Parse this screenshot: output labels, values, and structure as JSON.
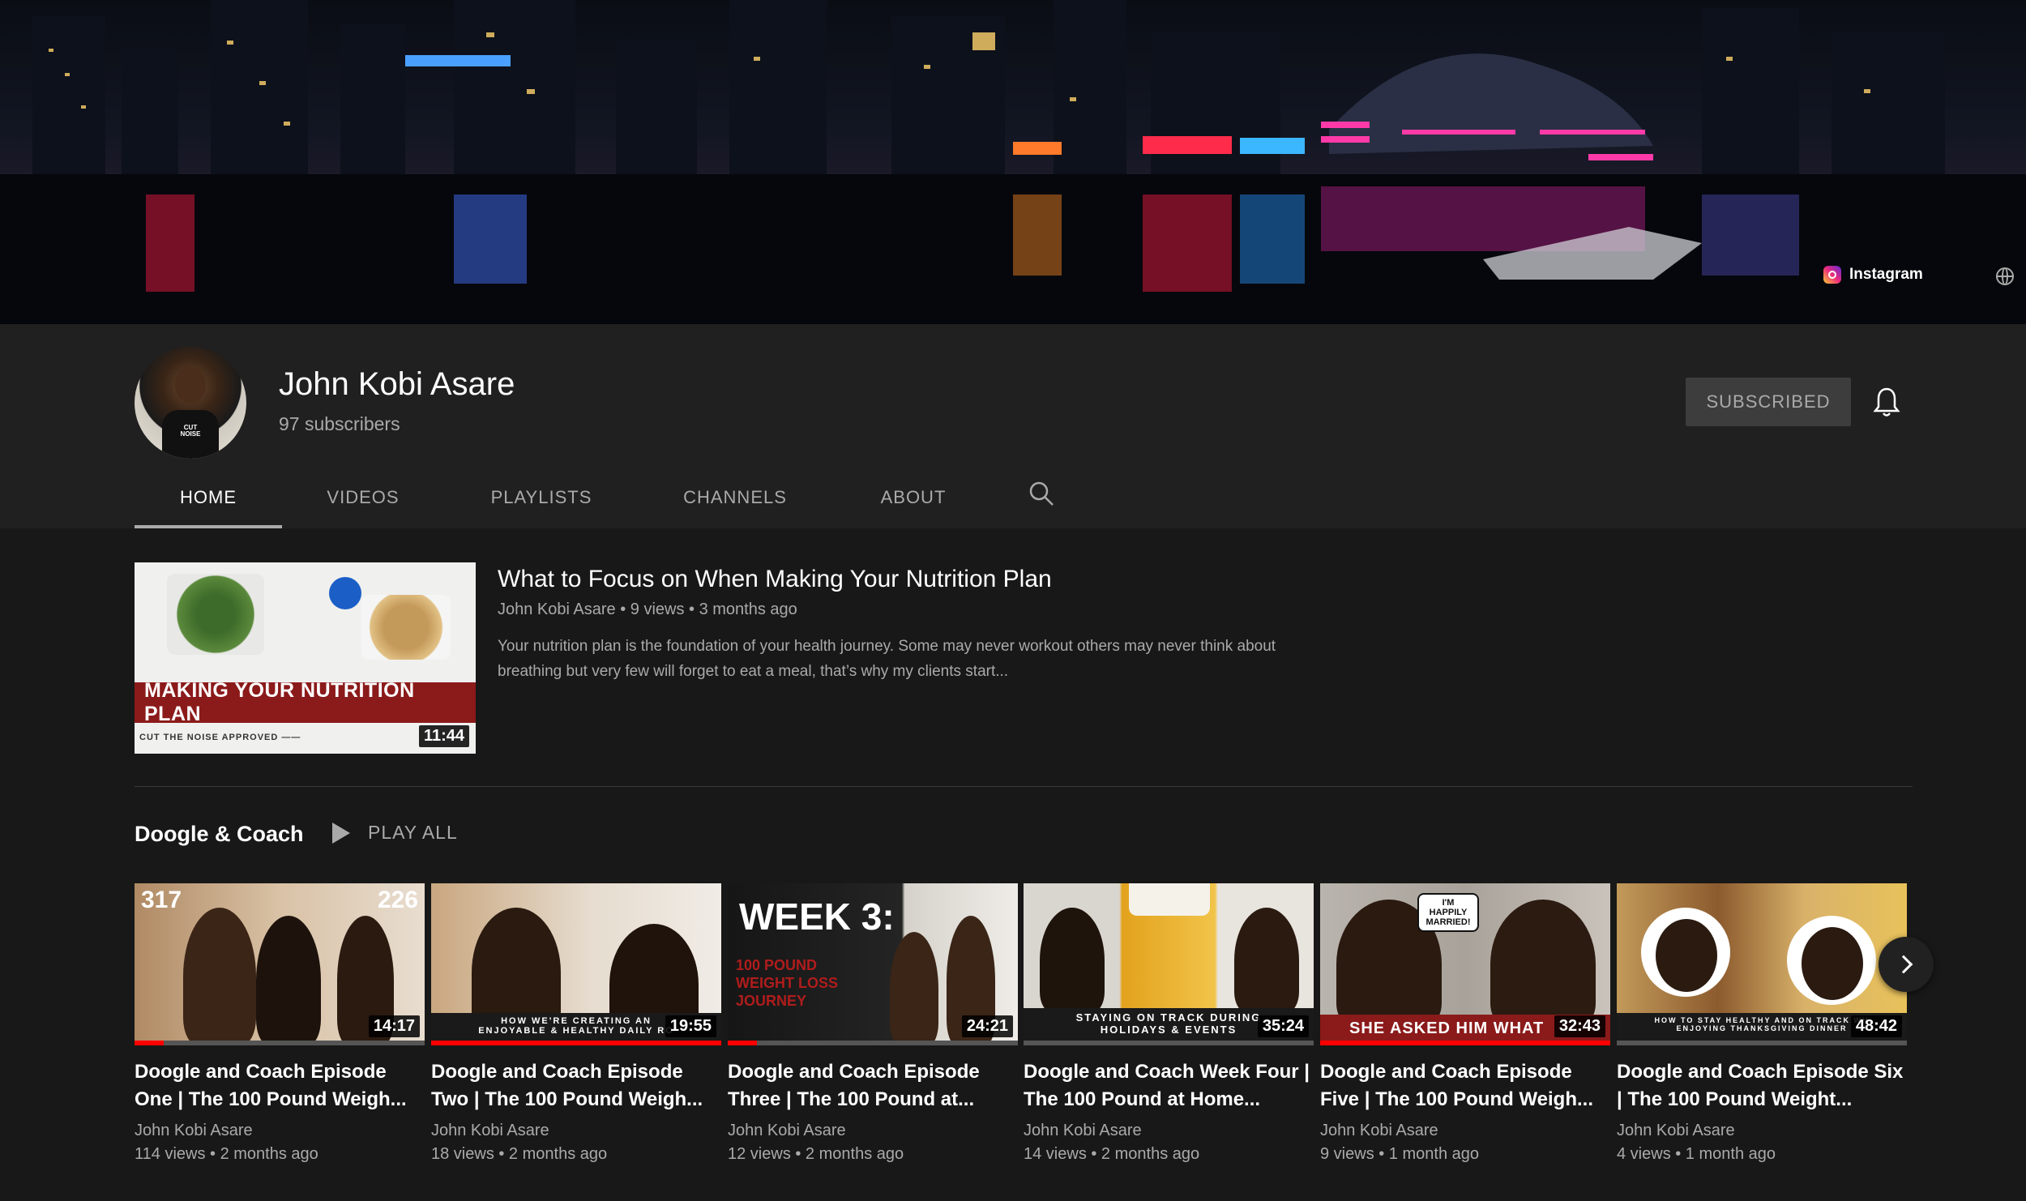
{
  "banner": {
    "links": [
      {
        "label": "Instagram",
        "icon": "instagram-icon"
      }
    ],
    "globe_icon": "globe-icon"
  },
  "channel": {
    "name": "John Kobi Asare",
    "subscribers": "97 subscribers",
    "subscribe_label": "SUBSCRIBED",
    "avatar_text": "CUT NOISE"
  },
  "tabs": [
    {
      "label": "HOME",
      "active": true
    },
    {
      "label": "VIDEOS",
      "active": false
    },
    {
      "label": "PLAYLISTS",
      "active": false
    },
    {
      "label": "CHANNELS",
      "active": false
    },
    {
      "label": "ABOUT",
      "active": false
    }
  ],
  "featured": {
    "title": "What to Focus on When Making Your Nutrition Plan",
    "meta": "John Kobi Asare • 9 views • 3 months ago",
    "description": "Your nutrition plan is the foundation of your health journey. Some may never workout others may never think about breathing but very few will forget to eat a meal, that’s why my clients start...",
    "thumb_text": "MAKING YOUR NUTRITION PLAN",
    "thumb_tagline": "CUT THE NOISE APPROVED ——",
    "duration": "11:44"
  },
  "shelf": {
    "title": "Doogle & Coach",
    "play_all": "PLAY ALL",
    "videos": [
      {
        "title": "Doogle and Coach Episode One | The 100 Pound Weigh...",
        "channel": "John Kobi Asare",
        "meta": "114 views • 2 months ago",
        "duration": "14:17",
        "thumb_text_a": "317",
        "thumb_text_b": "226",
        "progress": 0.1
      },
      {
        "title": "Doogle and Coach Episode Two | The 100 Pound Weigh...",
        "channel": "John Kobi Asare",
        "meta": "18 views • 2 months ago",
        "duration": "19:55",
        "thumb_text_a": "HOW WE'RE CREATING AN",
        "thumb_text_b": "ENJOYABLE & HEALTHY DAILY RO",
        "progress": 1.0
      },
      {
        "title": "Doogle and Coach Episode Three | The 100 Pound at...",
        "channel": "John Kobi Asare",
        "meta": "12 views • 2 months ago",
        "duration": "24:21",
        "thumb_text_a": "WEEK 3:",
        "thumb_text_b": "100 POUND WEIGHT LOSS JOURNEY",
        "progress": 0.1
      },
      {
        "title": "Doogle and Coach Week Four | The 100 Pound at Home...",
        "channel": "John Kobi Asare",
        "meta": "14 views • 2 months ago",
        "duration": "35:24",
        "thumb_text_a": "STAYING ON TRACK DURING",
        "thumb_text_b": "HOLIDAYS & EVENTS",
        "progress": 0.0
      },
      {
        "title": "Doogle and Coach Episode Five | The 100 Pound Weigh...",
        "channel": "John Kobi Asare",
        "meta": "9 views • 1 month ago",
        "duration": "32:43",
        "thumb_text_a": "SHE ASKED HIM WHAT",
        "thumb_text_b": "I'M HAPPILY MARRIED!",
        "progress": 1.0
      },
      {
        "title": "Doogle and Coach Episode Six | The 100 Pound Weight...",
        "channel": "John Kobi Asare",
        "meta": "4 views • 1 month ago",
        "duration": "48:42",
        "thumb_text_a": "HOW TO STAY HEALTHY AND ON TRACK WH",
        "thumb_text_b": "ENJOYING THANKSGIVING DINNER",
        "progress": 0.0
      }
    ]
  },
  "colors": {
    "background": "#181818",
    "header": "#202020",
    "accent_red": "#ff0000",
    "muted_text": "#aaaaaa"
  }
}
